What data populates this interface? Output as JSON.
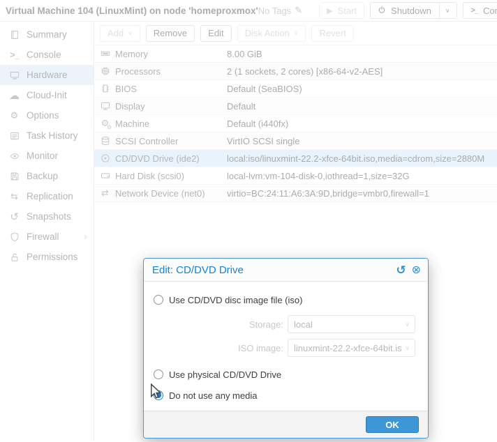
{
  "header": {
    "title": "Virtual Machine 104 (LinuxMint) on node 'homeproxmox'",
    "tags_label": "No Tags",
    "start_label": "Start",
    "shutdown_label": "Shutdown",
    "console_label": "Console"
  },
  "sidebar": {
    "items": [
      {
        "label": "Summary",
        "icon": "book-icon",
        "selected": false
      },
      {
        "label": "Console",
        "icon": "terminal-icon",
        "selected": false
      },
      {
        "label": "Hardware",
        "icon": "monitor-icon",
        "selected": true
      },
      {
        "label": "Cloud-Init",
        "icon": "cloud-icon",
        "selected": false
      },
      {
        "label": "Options",
        "icon": "gear-icon",
        "selected": false
      },
      {
        "label": "Task History",
        "icon": "list-icon",
        "selected": false
      },
      {
        "label": "Monitor",
        "icon": "eye-icon",
        "selected": false
      },
      {
        "label": "Backup",
        "icon": "floppy-icon",
        "selected": false
      },
      {
        "label": "Replication",
        "icon": "sync-icon",
        "selected": false
      },
      {
        "label": "Snapshots",
        "icon": "history-icon",
        "selected": false
      },
      {
        "label": "Firewall",
        "icon": "shield-icon",
        "selected": false,
        "has_submenu": true
      },
      {
        "label": "Permissions",
        "icon": "unlock-icon",
        "selected": false
      }
    ]
  },
  "toolbar": {
    "buttons": [
      {
        "label": "Add",
        "caret": true,
        "enabled": false
      },
      {
        "label": "Remove",
        "caret": false,
        "enabled": true
      },
      {
        "label": "Edit",
        "caret": false,
        "enabled": true
      },
      {
        "label": "Disk Action",
        "caret": true,
        "enabled": false
      },
      {
        "label": "Revert",
        "caret": false,
        "enabled": false
      }
    ]
  },
  "hardware": {
    "rows": [
      {
        "icon": "memory-icon",
        "label": "Memory",
        "value": "8.00 GiB",
        "selected": false
      },
      {
        "icon": "cpu-icon",
        "label": "Processors",
        "value": "2 (1 sockets, 2 cores) [x86-64-v2-AES]",
        "selected": false
      },
      {
        "icon": "chip-icon",
        "label": "BIOS",
        "value": "Default (SeaBIOS)",
        "selected": false
      },
      {
        "icon": "monitor-icon",
        "label": "Display",
        "value": "Default",
        "selected": false
      },
      {
        "icon": "gears-icon",
        "label": "Machine",
        "value": "Default (i440fx)",
        "selected": false
      },
      {
        "icon": "database-icon",
        "label": "SCSI Controller",
        "value": "VirtIO SCSI single",
        "selected": false
      },
      {
        "icon": "cd-icon",
        "label": "CD/DVD Drive (ide2)",
        "value": "local:iso/linuxmint-22.2-xfce-64bit.iso,media=cdrom,size=2880M",
        "selected": true
      },
      {
        "icon": "hdd-icon",
        "label": "Hard Disk (scsi0)",
        "value": "local-lvm:vm-104-disk-0,iothread=1,size=32G",
        "selected": false
      },
      {
        "icon": "exchange-icon",
        "label": "Network Device (net0)",
        "value": "virtio=BC:24:11:A6:3A:9D,bridge=vmbr0,firewall=1",
        "selected": false
      }
    ]
  },
  "dialog": {
    "title": "Edit: CD/DVD Drive",
    "option_iso": "Use CD/DVD disc image file (iso)",
    "option_physical": "Use physical CD/DVD Drive",
    "option_none": "Do not use any media",
    "selected_option": "Do not use any media",
    "storage_label": "Storage:",
    "storage_value": "local",
    "iso_label": "ISO image:",
    "iso_value": "linuxmint-22.2-xfce-64bit.is",
    "ok_label": "OK"
  },
  "colors": {
    "accent_blue": "#1583d6",
    "ok_button": "#3d96d6",
    "selection_bg": "#cfe4f6",
    "dialog_border": "#4a9bd4"
  }
}
